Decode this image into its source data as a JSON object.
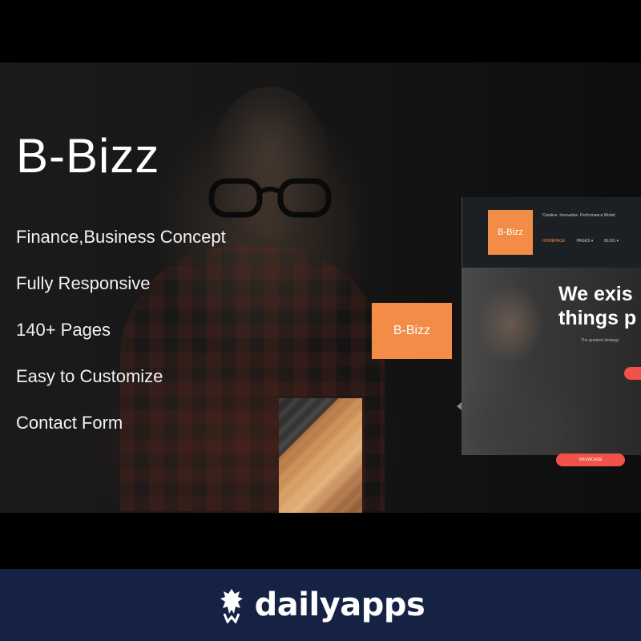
{
  "hero": {
    "title": "B-Bizz",
    "features": [
      "Finance,Business Concept",
      "Fully Responsive",
      "140+ Pages",
      "Easy to Customize",
      "Contact Form"
    ],
    "badge_label": "B-Bizz"
  },
  "preview": {
    "logo_label": "B-Bizz",
    "tagline": "Creative. Innovative. Performance Model",
    "nav": [
      "HOMEPAGE",
      "PAGES ▾",
      "BLOG ▾"
    ],
    "headline_line1": "We exis",
    "headline_line2": "things p",
    "subtext": "The greatest strategy",
    "cta_label": "SHOWCASE"
  },
  "footer": {
    "brand": "dailyapps"
  },
  "colors": {
    "accent_orange": "#f28c46",
    "cta_pink": "#f0524a",
    "footer_bg": "#152244"
  }
}
